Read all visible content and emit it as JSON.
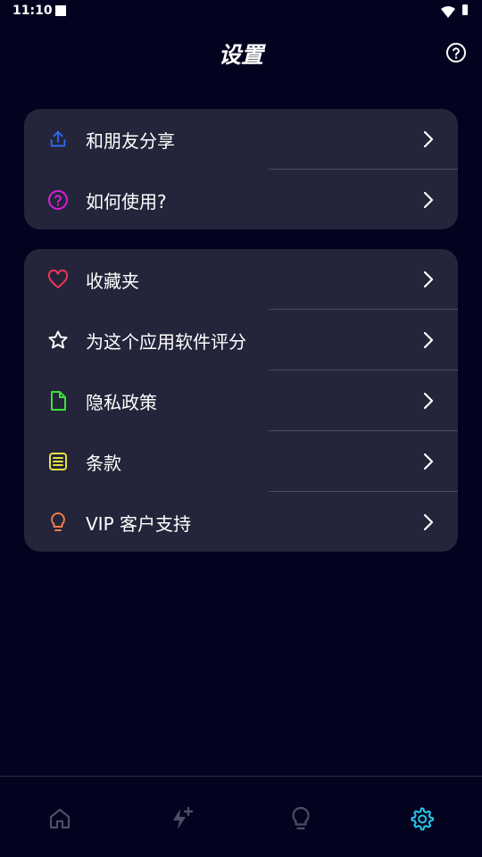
{
  "status_bar": {
    "time": "11:10"
  },
  "header": {
    "title": "设置",
    "help_icon": "question-circle-icon"
  },
  "sections": [
    {
      "items": [
        {
          "label": "和朋友分享",
          "icon": "share-upload-icon",
          "icon_color": "#2d6cf2"
        },
        {
          "label": "如何使用?",
          "icon": "question-circle-icon",
          "icon_color": "#d91ed6"
        }
      ]
    },
    {
      "items": [
        {
          "label": "收藏夹",
          "icon": "heart-icon",
          "icon_color": "#f0345c"
        },
        {
          "label": "为这个应用软件评分",
          "icon": "star-icon",
          "icon_color": "#ffffff"
        },
        {
          "label": "隐私政策",
          "icon": "document-icon",
          "icon_color": "#3ee03a"
        },
        {
          "label": "条款",
          "icon": "list-document-icon",
          "icon_color": "#e8e042"
        },
        {
          "label": "VIP 客户支持",
          "icon": "lightbulb-icon",
          "icon_color": "#f07e4a"
        }
      ]
    }
  ],
  "bottom_nav": {
    "items": [
      {
        "icon": "home-icon",
        "active": false
      },
      {
        "icon": "lightning-plus-icon",
        "active": false
      },
      {
        "icon": "lightbulb-icon",
        "active": false
      },
      {
        "icon": "settings-gear-icon",
        "active": true
      }
    ],
    "active_color": "#29c9f0",
    "inactive_color": "#4c4e66"
  },
  "colors": {
    "background": "#03031f",
    "card": "#24253a",
    "divider": "#4a4b60"
  }
}
